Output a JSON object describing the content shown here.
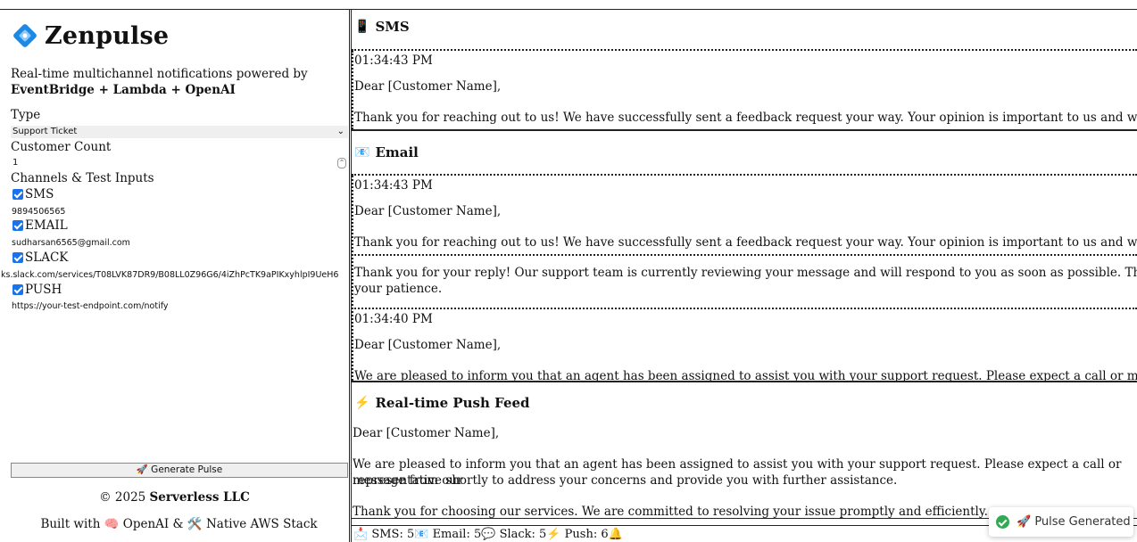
{
  "app": {
    "name": "Zenpulse",
    "tagline_line1": "Real-time multichannel notifications powered by",
    "tagline_line2": "EventBridge + Lambda + OpenAI"
  },
  "form": {
    "type_label": "Type",
    "type_value": "Support Ticket",
    "count_label": "Customer Count",
    "count_value": "1",
    "channels_label": "Channels & Test Inputs",
    "channels": [
      {
        "label": "SMS",
        "checked": true,
        "value": "9894506565"
      },
      {
        "label": "EMAIL",
        "checked": true,
        "value": "sudharsan6565@gmail.com"
      },
      {
        "label": "SLACK",
        "checked": true,
        "value": "ks.slack.com/services/T08LVK87DR9/B08LL0Z96G6/4iZhPcTK9aPIKxyhlpI9UeH6"
      },
      {
        "label": "PUSH",
        "checked": true,
        "value": "https://your-test-endpoint.com/notify"
      }
    ],
    "generate_label": "🚀 Generate Pulse"
  },
  "footer": {
    "copyright_prefix": "© 2025 ",
    "copyright_company": "Serverless LLC",
    "built_with": "Built with 🧠 OpenAI & 🛠️ Native AWS Stack"
  },
  "sms": {
    "title": "SMS",
    "icon": "mobile-phone-icon",
    "time": "01:34:43 PM",
    "greeting": "Dear [Customer Name],",
    "body": "Thank you for reaching out to us! We have successfully sent a feedback request your way. Your opinion is important to us and we appreciate"
  },
  "email": {
    "title": "Email",
    "icon": "envelope-icon",
    "msg1": {
      "time": "01:34:43 PM",
      "greeting": "Dear [Customer Name],",
      "body": "Thank you for reaching out to us! We have successfully sent a feedback request your way. Your opinion is important to us and we appreciate"
    },
    "msg2": {
      "line1": "Thank you for your reply! Our support team is currently reviewing your message and will respond to you as soon as possible. Thank you for",
      "line2": "your patience."
    },
    "msg3": {
      "time": "01:34:40 PM",
      "greeting": "Dear [Customer Name],",
      "body": "We are pleased to inform you that an agent has been assigned to assist you with your support request. Please expect a call or message from our"
    }
  },
  "push": {
    "title": "Real-time Push Feed",
    "icon": "lightning-icon",
    "greeting": "Dear [Customer Name],",
    "body_line1": "We are pleased to inform you that an agent has been assigned to assist you with your support request. Please expect a call or message from our",
    "body_line2": "representative shortly to address your concerns and provide you with further assistance.",
    "body_line3": "Thank you for choosing our services. We are committed to resolving your issue promptly and efficiently."
  },
  "status": {
    "sms": "SMS: 5",
    "email": "Email: 5",
    "slack": "Slack: 5",
    "push": "Push: 6"
  },
  "toast": {
    "text": "🚀 Pulse Generated"
  },
  "colors": {
    "accent": "#1a73e8",
    "success": "#34a853"
  }
}
